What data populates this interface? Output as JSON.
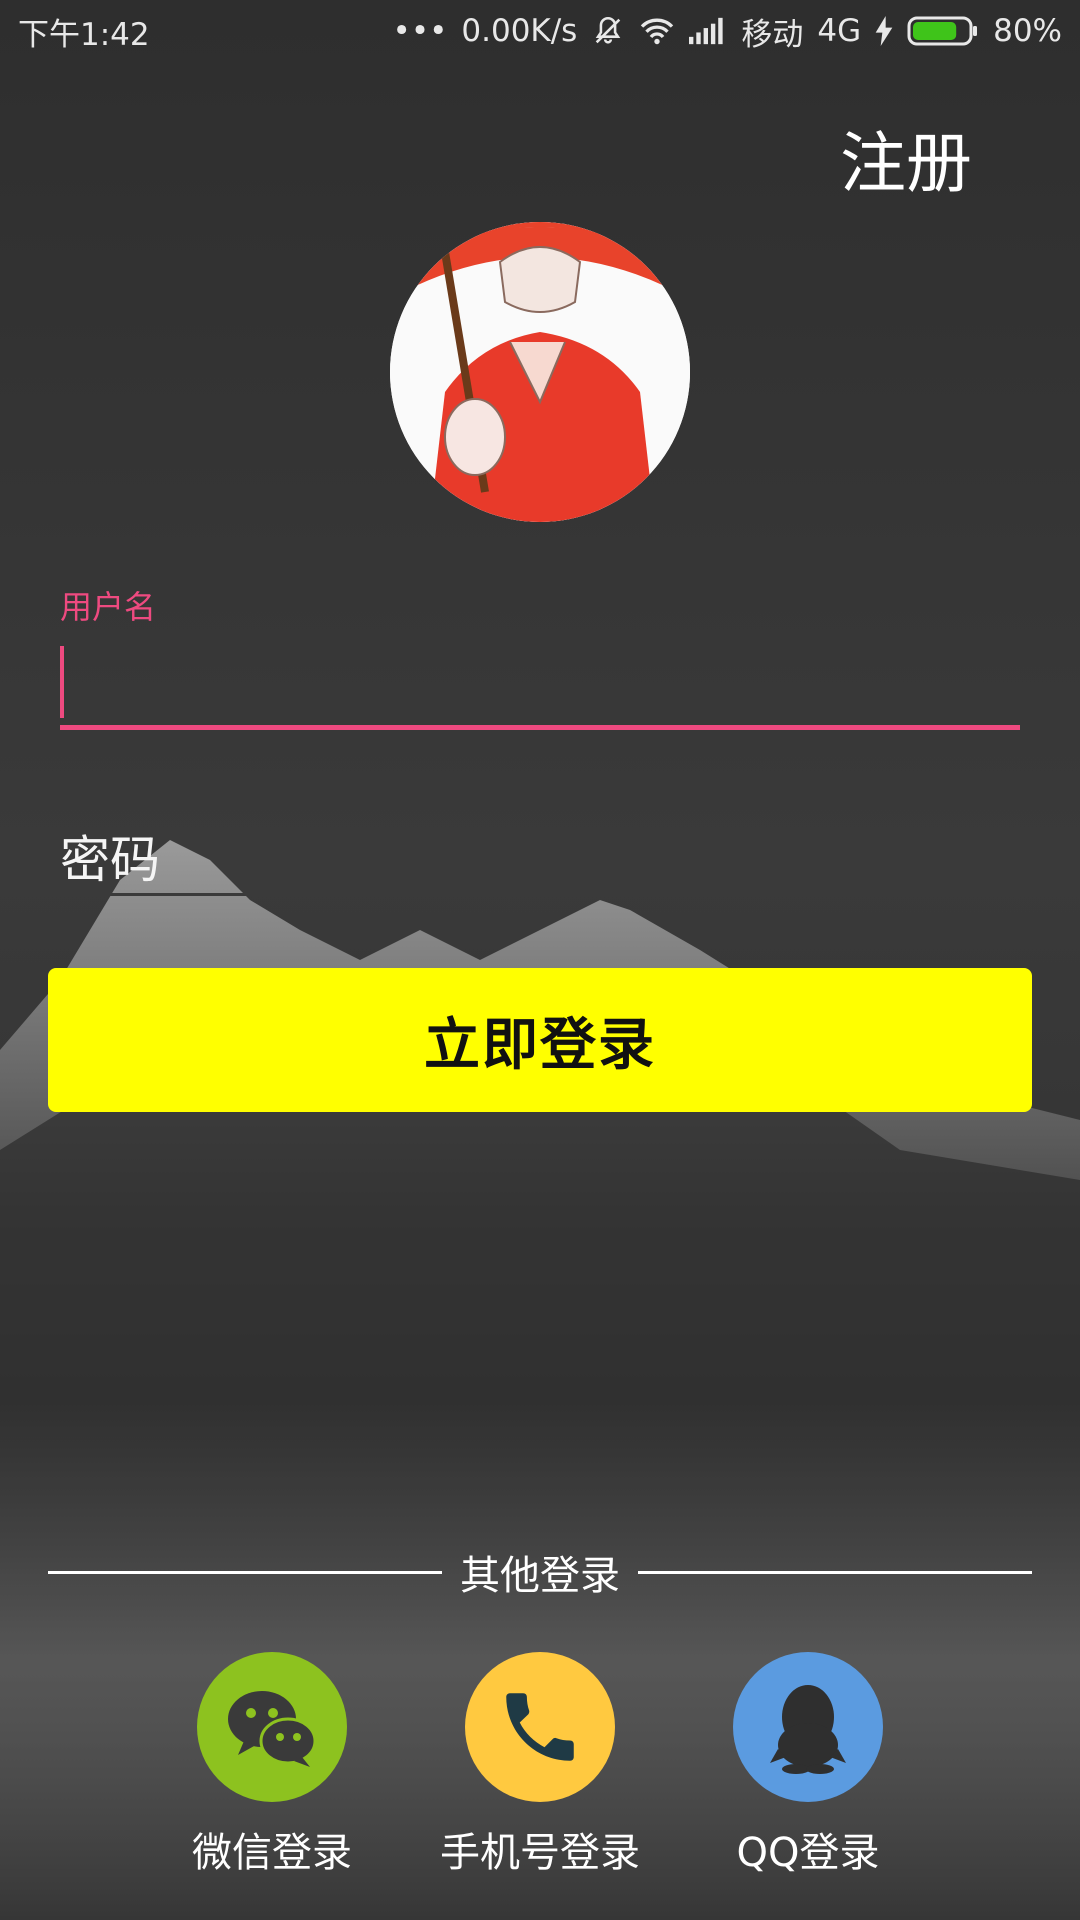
{
  "status_bar": {
    "time": "下午1:42",
    "net_speed": "0.00K/s",
    "carrier": "移动",
    "network": "4G",
    "battery": "80%",
    "battery_level": 0.8
  },
  "header": {
    "register_label": "注册"
  },
  "form": {
    "username_label": "用户名",
    "username_value": "",
    "password_placeholder": "密码",
    "login_button": "立即登录"
  },
  "other_login": {
    "title": "其他登录",
    "options": [
      {
        "label": "微信登录",
        "icon": "wechat-icon",
        "color": "#8dc21f"
      },
      {
        "label": "手机号登录",
        "icon": "phone-icon",
        "color": "#ffc940"
      },
      {
        "label": "QQ登录",
        "icon": "qq-icon",
        "color": "#5b9be0"
      }
    ]
  },
  "colors": {
    "accent": "#ee4a80",
    "login_button_bg": "#ffff00"
  }
}
